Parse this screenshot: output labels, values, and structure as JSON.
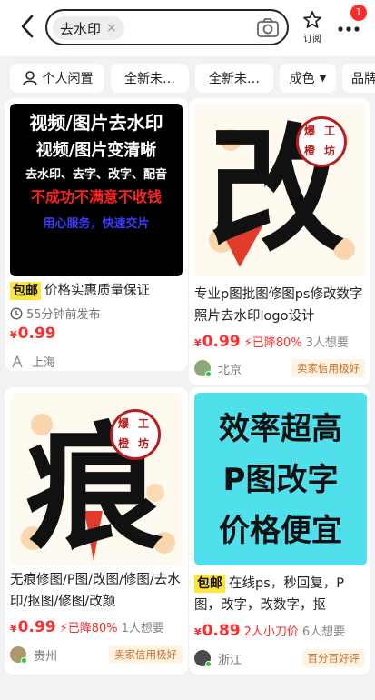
{
  "search": {
    "query": "去水印",
    "clear": "×"
  },
  "header": {
    "subscribe_label": "订阅",
    "badge_count": "1"
  },
  "filters": [
    {
      "label": "个人闲置"
    },
    {
      "label": "全新未…"
    },
    {
      "label": "全新未…"
    },
    {
      "label": "成色"
    },
    {
      "label": "品牌"
    }
  ],
  "cards": [
    {
      "thumb_lines": [
        "视频/图片去水印",
        "视频/图片变清晰",
        "去水印、去字、改字、配音",
        "不成功不满意不收钱",
        "用心服务，快速交片"
      ],
      "free_tag": "包邮",
      "title": "价格实惠质量保证",
      "time": "55分钟前发布",
      "price_symbol": "¥",
      "price": "0.99",
      "location": "上海"
    },
    {
      "thumb_char": "改",
      "stamp": [
        "爆",
        "工",
        "橙",
        "坊"
      ],
      "title": "专业p图批图修图ps修改数字照片去水印logo设计",
      "price_symbol": "¥",
      "price": "0.99",
      "drop": "已降80%",
      "want": "3人想要",
      "location": "北京",
      "credit": "卖家信用极好"
    },
    {
      "thumb_char": "痕",
      "stamp": [
        "爆",
        "工",
        "橙",
        "坊"
      ],
      "title": "无痕修图/P图/改图/修图/去水印/抠图/修图/改颜",
      "price_symbol": "¥",
      "price": "0.99",
      "drop": "已降80%",
      "want": "1人想要",
      "location": "贵州",
      "credit": "卖家信用极好"
    },
    {
      "thumb_lines": [
        "效率超高",
        "P图改字",
        "价格便宜"
      ],
      "free_tag": "包邮",
      "title": "在线ps，秒回复，P图，改字，改数字，抠",
      "price_symbol": "¥",
      "price": "0.89",
      "drop": "2人小刀价",
      "want": "6人想要",
      "location": "浙江",
      "credit": "百分百好评"
    }
  ],
  "colors": {
    "price": "#ff2d2d",
    "free_tag": "#ffe43b",
    "credit_text": "#c9712a",
    "thumb4_bg": "#4fe0ec"
  }
}
